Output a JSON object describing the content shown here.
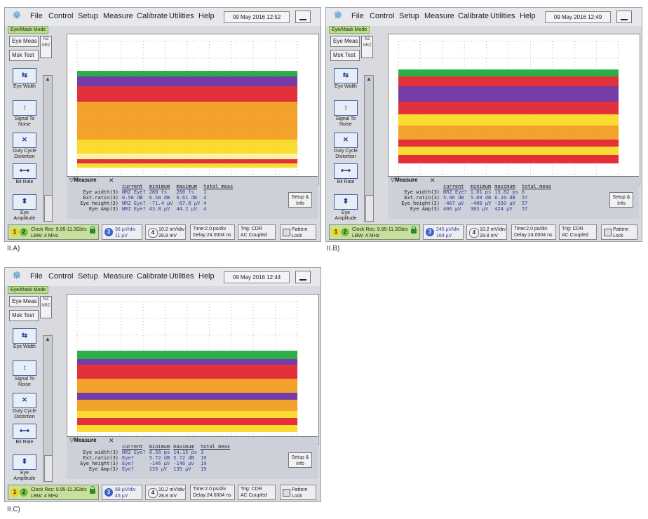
{
  "menu": [
    "File",
    "Control",
    "Setup",
    "Measure",
    "Calibrate",
    "Utilities",
    "Help"
  ],
  "mode_label": "Eye/Mask Mode",
  "sidebar": {
    "eye_meas": "Eye Meas",
    "msk_test": "Msk Test",
    "rz_label": "RZ",
    "nrz_label": "NRZ",
    "tools": [
      {
        "icon": "eye-width-icon",
        "label": "Eye Width"
      },
      {
        "icon": "signal-to-noise-icon",
        "label": "Signal To Noise"
      },
      {
        "icon": "duty-cycle-distortion-icon",
        "label": "Duty Cycle Distortion"
      },
      {
        "icon": "bit-rate-icon",
        "label": "Bit Rate"
      },
      {
        "icon": "eye-amplitude-icon",
        "label": "Eye Amplitude"
      }
    ]
  },
  "measure": {
    "title": "Measure",
    "headers": [
      "current",
      "minimum",
      "maximum",
      "total meas"
    ],
    "setup_label": "Setup & Info",
    "row_labels": [
      "Eye width(3)",
      "Ext.ratio(3)",
      "Eye height(3)",
      "Eye Amp(3)"
    ]
  },
  "status_common": {
    "clock": "Clock Rec: 9.95-11.3Gb/s",
    "lbw": "LBW: 4 MHz",
    "ch4_scale": "10.2 mV/div",
    "ch4_offset": "28.8 mV",
    "time": "Time:2.0 ps/div",
    "delay": "Delay:24.0004 ns",
    "trig": "Trig: CDR",
    "coupling": "AC Coupled",
    "pattern": "Pattern",
    "lock": "Lock"
  },
  "panels": [
    {
      "caption": "II.A)",
      "date": "09 May 2016 12:52",
      "rows": [
        [
          "NRZ Eye?",
          "280 fs",
          "280 fs",
          "1"
        ],
        [
          "6.50 dB",
          "6.50 dB",
          "6.61 dB",
          "4"
        ],
        [
          "NRZ Eye?",
          "-71.4 µV",
          "-67.8 µV",
          "4"
        ],
        [
          "NRZ Eye?",
          "43.8 µV",
          "44.2 µV",
          "4"
        ]
      ],
      "ch3_scale": "36 µV/div",
      "ch3_offset": "11 µV"
    },
    {
      "caption": "II.B)",
      "date": "09 May 2016 12:49",
      "rows": [
        [
          "NRZ Eye?",
          "1.01 ps",
          "13.82 ps",
          "6"
        ],
        [
          "5.96 dB",
          "5.89 dB",
          "6.20 dB",
          "57"
        ],
        [
          "-467 µV",
          "-486 µV",
          "-250 µV",
          "57"
        ],
        [
          "406 µV",
          "383 µV",
          "424 µV",
          "57"
        ]
      ],
      "ch3_scale": "245 µV/div",
      "ch3_offset": "164 µV"
    },
    {
      "caption": "II.C)",
      "date": "09 May 2016 12:44",
      "rows": [
        [
          "NRZ Eye?",
          "8.56 ps",
          "14.15 ps",
          "3"
        ],
        [
          "Eye?",
          "5.72 dB",
          "5.72 dB",
          "19"
        ],
        [
          "Eye?",
          "-146 µV",
          "-146 µV",
          "19"
        ],
        [
          "Eye?",
          "135 µV",
          "135 µV",
          "19"
        ]
      ],
      "ch3_scale": "88 µV/div",
      "ch3_offset": "45 µV"
    }
  ],
  "colors": {
    "green": "#1aa83a",
    "purple": "#6a2ca0",
    "red": "#e0202a",
    "orange": "#f29a1a",
    "yellow": "#f8d820"
  }
}
